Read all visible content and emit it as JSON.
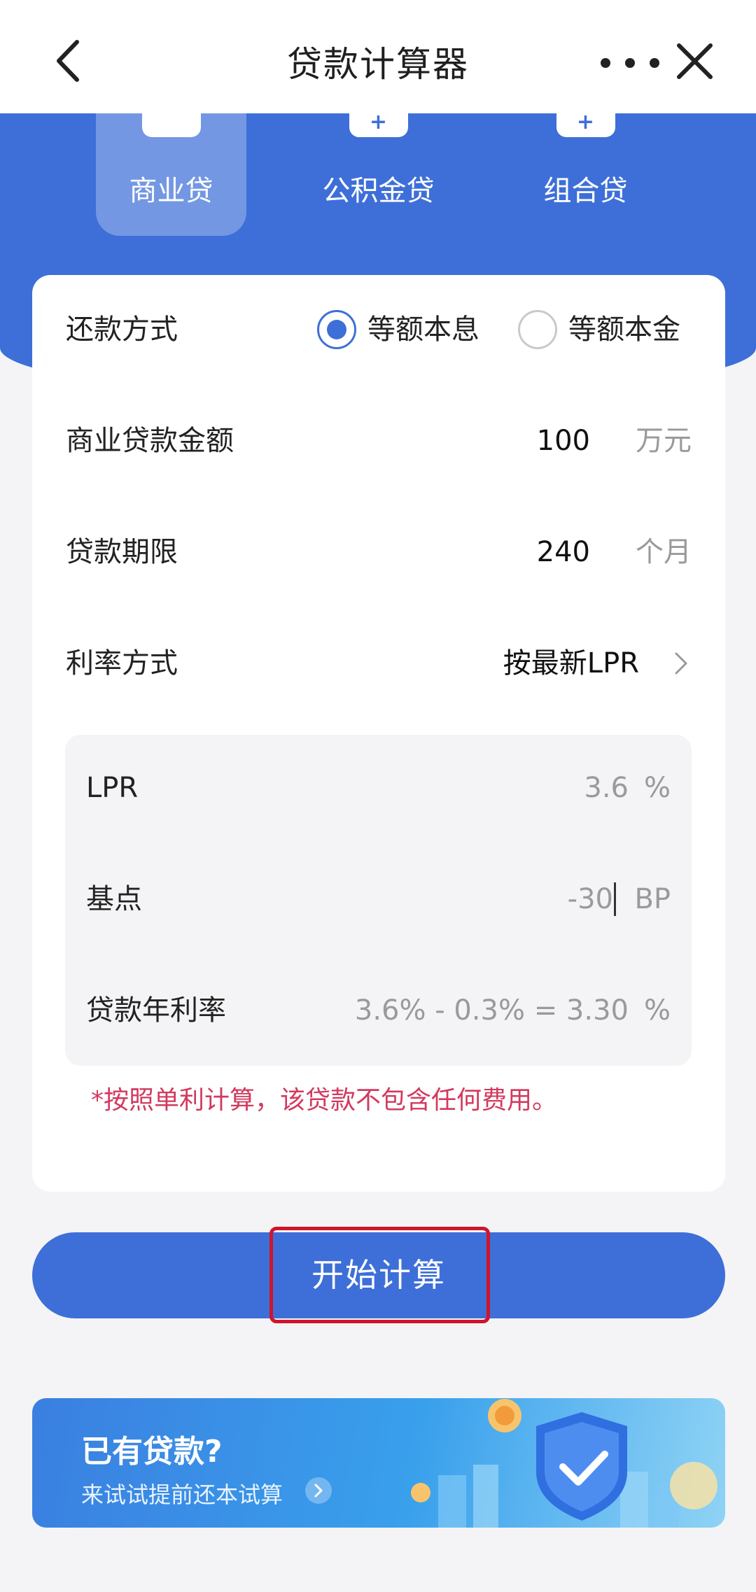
{
  "header": {
    "title": "贷款计算器",
    "back_icon": "chevron-left-icon",
    "more_icon": "more-horizontal-icon",
    "close_icon": "close-icon"
  },
  "tabs": [
    {
      "label": "商业贷",
      "active": true
    },
    {
      "label": "公积金贷",
      "active": false
    },
    {
      "label": "组合贷",
      "active": false
    }
  ],
  "form": {
    "repayment": {
      "label": "还款方式",
      "options": [
        {
          "label": "等额本息",
          "selected": true
        },
        {
          "label": "等额本金",
          "selected": false
        }
      ]
    },
    "amount": {
      "label": "商业贷款金额",
      "value": "100",
      "unit": "万元"
    },
    "term": {
      "label": "贷款期限",
      "value": "240",
      "unit": "个月"
    },
    "rate_mode": {
      "label": "利率方式",
      "value": "按最新LPR"
    },
    "lpr": {
      "label": "LPR",
      "value": "3.6",
      "unit": "%"
    },
    "basis_points": {
      "label": "基点",
      "value": "-30",
      "unit": "BP"
    },
    "annual_rate": {
      "label": "贷款年利率",
      "value": "3.6% - 0.3% = 3.30",
      "unit": "%"
    },
    "note": "*按照单利计算，该贷款不包含任何费用。"
  },
  "calculate_button": {
    "label": "开始计算"
  },
  "banner": {
    "title": "已有贷款?",
    "subtitle": "来试试提前还本试算"
  },
  "colors": {
    "accent": "#3e6fd8",
    "note": "#d23a5e",
    "highlight": "#d0142c"
  }
}
